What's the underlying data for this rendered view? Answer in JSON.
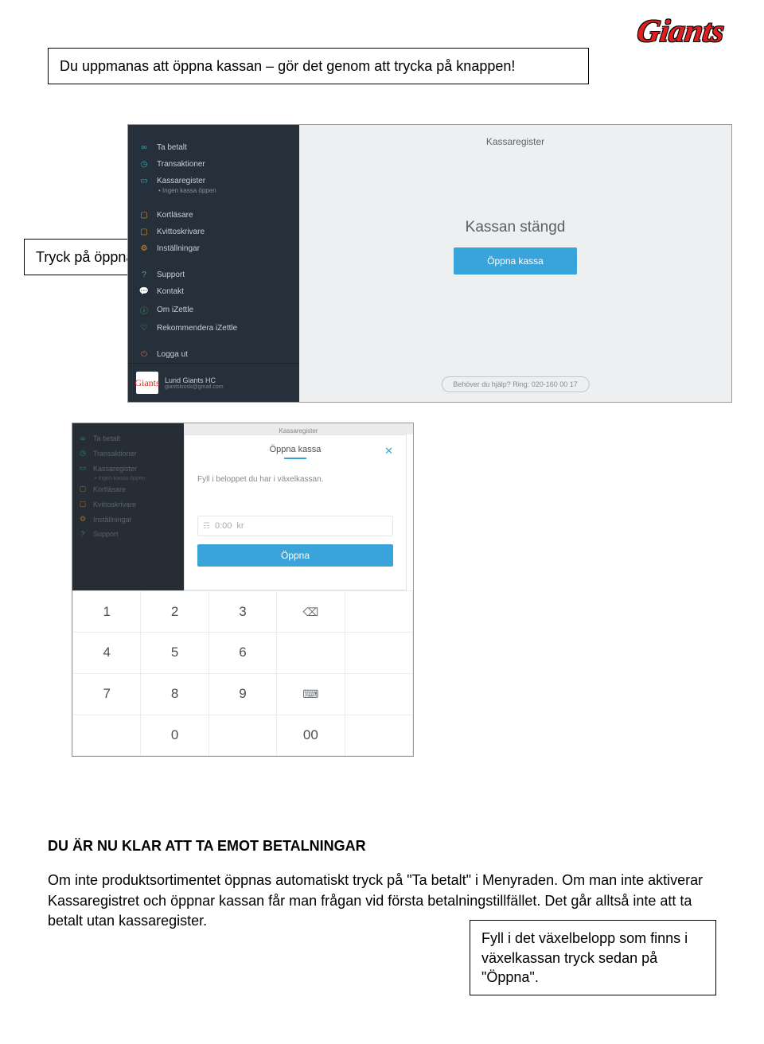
{
  "logo": "Giants",
  "box_top": "Du uppmanas att öppna kassan – gör det genom att trycka på knappen!",
  "box_left": "Tryck på öppna kassa",
  "box_right": "Fyll i det växelbelopp som finns i växelkassan tryck sedan på \"Öppna\".",
  "shot1": {
    "menu": {
      "ta_betalt": "Ta betalt",
      "transaktioner": "Transaktioner",
      "kassaregister": "Kassaregister",
      "kassaregister_sub": "• Ingen kassa öppen",
      "kortlasare": "Kortläsare",
      "kvittoskrivare": "Kvittoskrivare",
      "installningar": "Inställningar",
      "support": "Support",
      "kontakt": "Kontakt",
      "om_izettle": "Om iZettle",
      "rekommendera": "Rekommendera iZettle",
      "logga_ut": "Logga ut"
    },
    "account": {
      "name": "Lund Giants HC",
      "email": "giantskiosk@gmail.com",
      "avatar": "Giants"
    },
    "header": "Kassaregister",
    "title": "Kassan stängd",
    "open_btn": "Öppna kassa",
    "help_pill": "Behöver du hjälp? Ring: 020-160 00 17"
  },
  "shot2": {
    "dark_menu": {
      "ta_betalt": "Ta betalt",
      "transaktioner": "Transaktioner",
      "kassaregister": "Kassaregister",
      "kassaregister_sub": "• Ingen kassa öppen",
      "kortlasare": "Kortläsare",
      "kvittoskrivare": "Kvittoskrivare",
      "installningar": "Inställningar",
      "support": "Support"
    },
    "grey_header": "Kassaregister",
    "dialog": {
      "title": "Öppna kassa",
      "desc": "Fyll i beloppet du har i växelkassan.",
      "amount_value": "0:00",
      "amount_suffix": "kr",
      "open_btn": "Öppna"
    },
    "keypad": {
      "k1": "1",
      "k2": "2",
      "k3": "3",
      "k4": "4",
      "k5": "5",
      "k6": "6",
      "k7": "7",
      "k8": "8",
      "k9": "9",
      "k0": "0",
      "k00": "00"
    }
  },
  "bodytext": {
    "head": "DU ÄR NU KLAR ATT TA EMOT BETALNINGAR",
    "p": "Om inte produktsortimentet öppnas automatiskt tryck på \"Ta betalt\" i Menyraden. Om man inte aktiverar Kassaregistret och öppnar kassan får man frågan vid första betalningstillfället. Det går alltså inte att ta betalt utan kassaregister."
  }
}
